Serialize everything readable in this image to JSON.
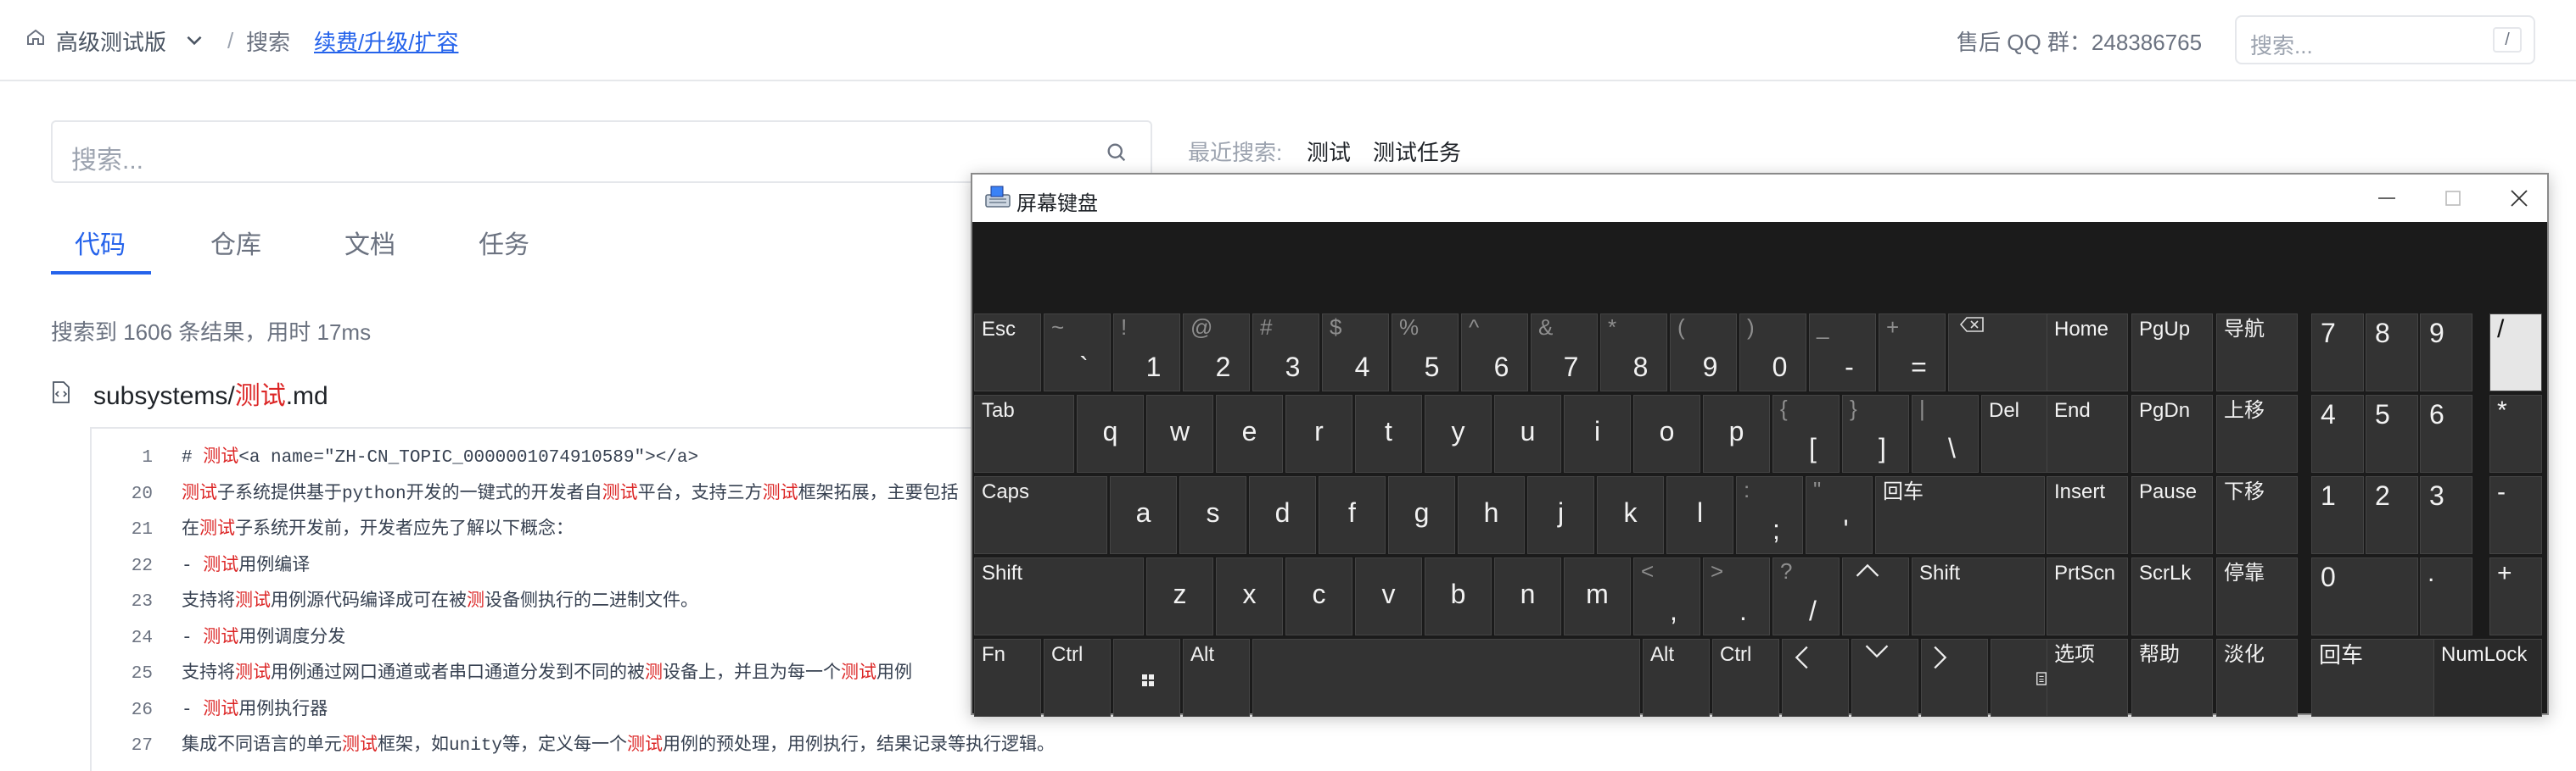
{
  "topbar": {
    "edition": "高级测试版",
    "sep": "/",
    "search_label": "搜索",
    "upgrade_link": "续费/升级/扩容",
    "qq_group": "售后 QQ 群：248386765",
    "search_placeholder": "搜索...",
    "shortcut": "/"
  },
  "search": {
    "placeholder": "搜索...",
    "recent_label": "最近搜索:",
    "recent": [
      "测试",
      "测试任务"
    ]
  },
  "tabs": [
    "代码",
    "仓库",
    "文档",
    "任务"
  ],
  "results": {
    "summary": "搜索到 1606 条结果，用时 17ms",
    "file_prefix": "subsystems/",
    "file_hl": "测试",
    "file_suffix": ".md"
  },
  "code_lines": [
    {
      "n": "1",
      "segs": [
        [
          "# ",
          0
        ],
        [
          "测试",
          1
        ],
        [
          "<a name=\"ZH-CN_TOPIC_0000001074910589\"></a>",
          0
        ]
      ]
    },
    {
      "n": "20",
      "segs": [
        [
          "测试",
          1
        ],
        [
          "子系统提供基于python开发的一键式的开发者自",
          0
        ],
        [
          "测试",
          1
        ],
        [
          "平台，支持三方",
          0
        ],
        [
          "测试",
          1
        ],
        [
          "框架拓展，主要包括",
          0
        ]
      ]
    },
    {
      "n": "21",
      "segs": [
        [
          "在",
          0
        ],
        [
          "测试",
          1
        ],
        [
          "子系统开发前，开发者应先了解以下概念：",
          0
        ]
      ]
    },
    {
      "n": "22",
      "segs": [
        [
          "-    ",
          0
        ],
        [
          "测试",
          1
        ],
        [
          "用例编译",
          0
        ]
      ]
    },
    {
      "n": "23",
      "segs": [
        [
          "     支持将",
          0
        ],
        [
          "测试",
          1
        ],
        [
          "用例源代码编译成可在被",
          0
        ],
        [
          "测",
          1
        ],
        [
          "设备侧执行的二进制文件。",
          0
        ]
      ]
    },
    {
      "n": "24",
      "segs": [
        [
          "-    ",
          0
        ],
        [
          "测试",
          1
        ],
        [
          "用例调度分发",
          0
        ]
      ]
    },
    {
      "n": "25",
      "segs": [
        [
          "     支持将",
          0
        ],
        [
          "测试",
          1
        ],
        [
          "用例通过网口通道或者串口通道分发到不同的被",
          0
        ],
        [
          "测",
          1
        ],
        [
          "设备上，并且为每一个",
          0
        ],
        [
          "测试",
          1
        ],
        [
          "用例",
          0
        ]
      ]
    },
    {
      "n": "26",
      "segs": [
        [
          "-    ",
          0
        ],
        [
          "测试",
          1
        ],
        [
          "用例执行器",
          0
        ]
      ]
    },
    {
      "n": "27",
      "segs": [
        [
          "     集成不同语言的单元",
          0
        ],
        [
          "测试",
          1
        ],
        [
          "框架，如unity等，定义每一个",
          0
        ],
        [
          "测试",
          1
        ],
        [
          "用例的预处理，用例执行，结果记录等执行逻辑。",
          0
        ]
      ]
    }
  ],
  "osk": {
    "title": "屏幕键盘",
    "row1": [
      {
        "l": "Esc"
      },
      {
        "s": "~",
        "p": "`"
      },
      {
        "s": "!",
        "p": "1"
      },
      {
        "s": "@",
        "p": "2"
      },
      {
        "s": "#",
        "p": "3"
      },
      {
        "s": "$",
        "p": "4"
      },
      {
        "s": "%",
        "p": "5"
      },
      {
        "s": "^",
        "p": "6"
      },
      {
        "s": "&",
        "p": "7"
      },
      {
        "s": "*",
        "p": "8"
      },
      {
        "s": "(",
        "p": "9"
      },
      {
        "s": ")",
        "p": "0"
      },
      {
        "s": "_",
        "p": "-"
      },
      {
        "s": "+",
        "p": "="
      },
      {
        "i": "backspace"
      }
    ],
    "row2": [
      {
        "l": "Tab"
      },
      {
        "c": "q"
      },
      {
        "c": "w"
      },
      {
        "c": "e"
      },
      {
        "c": "r"
      },
      {
        "c": "t"
      },
      {
        "c": "y"
      },
      {
        "c": "u"
      },
      {
        "c": "i"
      },
      {
        "c": "o"
      },
      {
        "c": "p"
      },
      {
        "s": "{",
        "p": "["
      },
      {
        "s": "}",
        "p": "]"
      },
      {
        "s": "|",
        "p": "\\"
      },
      {
        "l": "Del"
      }
    ],
    "row3": [
      {
        "l": "Caps"
      },
      {
        "c": "a"
      },
      {
        "c": "s"
      },
      {
        "c": "d"
      },
      {
        "c": "f"
      },
      {
        "c": "g"
      },
      {
        "c": "h"
      },
      {
        "c": "j"
      },
      {
        "c": "k"
      },
      {
        "c": "l"
      },
      {
        "s": ":",
        "p": ";"
      },
      {
        "s": "\"",
        "p": "'"
      },
      {
        "l": "回车"
      }
    ],
    "row4": [
      {
        "l": "Shift"
      },
      {
        "c": "z"
      },
      {
        "c": "x"
      },
      {
        "c": "c"
      },
      {
        "c": "v"
      },
      {
        "c": "b"
      },
      {
        "c": "n"
      },
      {
        "c": "m"
      },
      {
        "s": "<",
        "p": ","
      },
      {
        "s": ">",
        "p": "."
      },
      {
        "s": "?",
        "p": "/"
      },
      {
        "i": "up"
      },
      {
        "l": "Shift"
      }
    ],
    "row5": [
      {
        "l": "Fn"
      },
      {
        "l": "Ctrl"
      },
      {
        "i": "windows"
      },
      {
        "l": "Alt"
      },
      {
        "l": ""
      },
      {
        "l": "Alt"
      },
      {
        "l": "Ctrl"
      },
      {
        "i": "left"
      },
      {
        "i": "down"
      },
      {
        "i": "right"
      },
      {
        "i": "menu"
      }
    ],
    "nav": [
      [
        "Home",
        "PgUp",
        "导航"
      ],
      [
        "End",
        "PgDn",
        "上移"
      ],
      [
        "Insert",
        "Pause",
        "下移"
      ],
      [
        "PrtScn",
        "ScrLk",
        "停靠"
      ],
      [
        "选项",
        "帮助",
        "淡化"
      ]
    ],
    "numpad": [
      [
        "7",
        "8",
        "9",
        "/"
      ],
      [
        "4",
        "5",
        "6",
        "*"
      ],
      [
        "1",
        "2",
        "3",
        "-"
      ],
      [
        "0",
        ".",
        "+"
      ],
      [
        "回车",
        "NumLock"
      ]
    ]
  }
}
